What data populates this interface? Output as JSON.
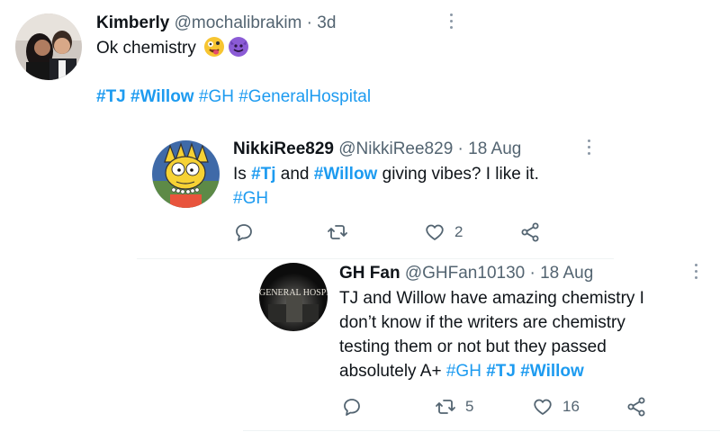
{
  "tweets": [
    {
      "name": "Kimberly",
      "handle": "@mochalibrakim",
      "dot": "·",
      "time": "3d",
      "text": "Ok chemistry",
      "emojis": [
        "zany-face-emoji",
        "smiling-imp-emoji"
      ],
      "hashtags": [
        "#TJ",
        "#Willow",
        "#GH",
        "#GeneralHospital"
      ]
    },
    {
      "name": "NikkiRee829",
      "handle": "@NikkiRee829",
      "dot": "·",
      "time": "18 Aug",
      "text_parts": [
        "Is ",
        "#Tj",
        " and ",
        "#Willow",
        " giving vibes? I like it."
      ],
      "hashtag_line2": "#GH",
      "counts": {
        "reply": "",
        "retweet": "",
        "like": "2"
      }
    },
    {
      "name": "GH Fan",
      "handle": "@GHFan10130",
      "dot": "·",
      "time": "18 Aug",
      "avatar_text": "GENERAL HOSPITAL",
      "lines": [
        "TJ and Willow have amazing chemistry I",
        "don’t know if the writers are chemistry",
        "testing them or not but they passed",
        "absolutely A+ "
      ],
      "hashtags": [
        "#GH",
        "#TJ",
        "#Willow"
      ],
      "counts": {
        "reply": "",
        "retweet": "5",
        "like": "16"
      }
    }
  ],
  "colors": {
    "link": "#1d9bf0",
    "muted": "#536471",
    "text": "#0f1419"
  },
  "icons": [
    "reply-icon",
    "retweet-icon",
    "like-icon",
    "share-icon",
    "more-icon"
  ]
}
